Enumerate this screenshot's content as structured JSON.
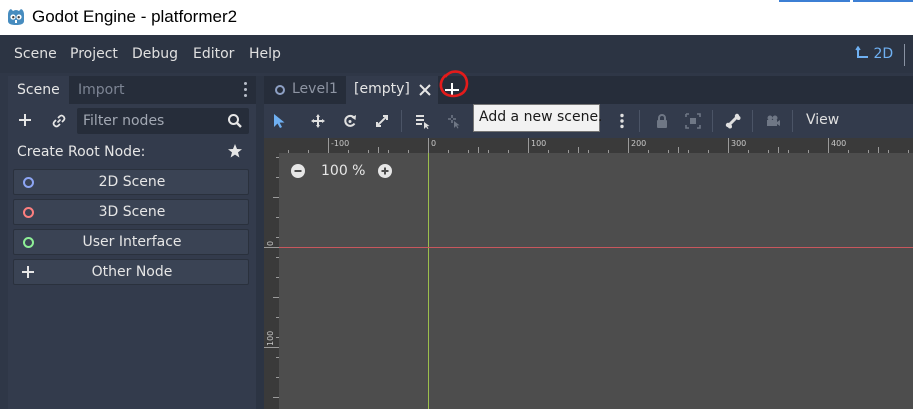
{
  "window": {
    "title": "Godot Engine - platformer2"
  },
  "menu": {
    "items": [
      "Scene",
      "Project",
      "Debug",
      "Editor",
      "Help"
    ],
    "mode_2d": "2D"
  },
  "dock": {
    "tabs": [
      "Scene",
      "Import"
    ],
    "filter_placeholder": "Filter nodes",
    "create_root_label": "Create Root Node:",
    "root_nodes": [
      {
        "label": "2D Scene",
        "icon": "circle-blue-icon",
        "color": "#8da5f3"
      },
      {
        "label": "3D Scene",
        "icon": "circle-red-icon",
        "color": "#fc7f7f"
      },
      {
        "label": "User Interface",
        "icon": "circle-green-icon",
        "color": "#8eef97"
      },
      {
        "label": "Other Node",
        "icon": "plus-icon",
        "color": "#e0e0e0"
      }
    ]
  },
  "scene_tabs": {
    "tabs": [
      "Level1",
      "[empty]"
    ],
    "active": "[empty]"
  },
  "tooltip": {
    "text": "Add a new scene."
  },
  "viewport": {
    "view_menu": "View",
    "zoom": "100 %",
    "ruler_top": [
      "-100",
      "0",
      "100",
      "200",
      "300",
      "400"
    ],
    "ruler_left": [
      "0",
      "100"
    ]
  },
  "colors": {
    "accent": "#6fb0f2",
    "annotation": "#e31b1b",
    "x_axis": "#c8575d",
    "y_axis": "#9cbf4c"
  }
}
